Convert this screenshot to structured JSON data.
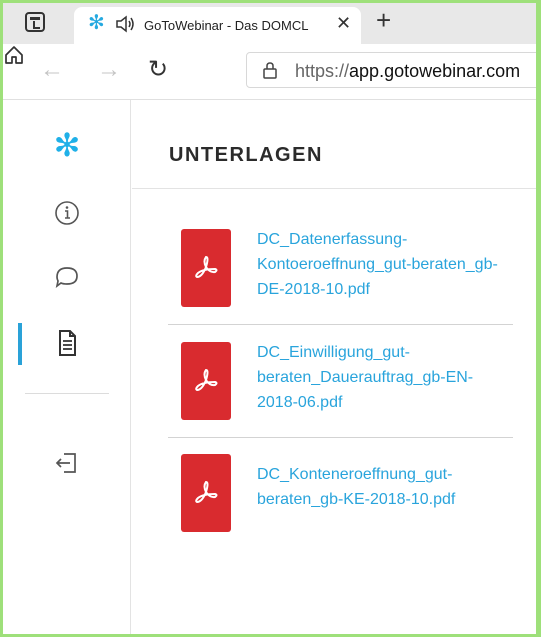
{
  "browser": {
    "tab": {
      "title": "GoToWebinar - Das DOMCL",
      "favicon": "snowflake-icon",
      "audio_icon": "speaker-icon",
      "close_icon": "close-icon"
    },
    "new_tab_icon": "plus-icon",
    "address": {
      "prefix": "https://",
      "host": "app.gotowebinar.com"
    },
    "nav_icons": [
      "back-arrow-icon",
      "forward-arrow-icon",
      "reload-icon",
      "home-icon",
      "lock-icon"
    ]
  },
  "sidebar": {
    "items": [
      {
        "icon": "gotowebinar-logo-icon",
        "active": false
      },
      {
        "icon": "info-icon",
        "active": false
      },
      {
        "icon": "chat-bubble-icon",
        "active": false
      },
      {
        "icon": "document-icon",
        "active": true
      },
      {
        "icon": "exit-icon",
        "active": false
      }
    ],
    "accent": "#2aa2d8"
  },
  "panel": {
    "title": "UNTERLAGEN",
    "documents": [
      {
        "name": "DC_Datenerfassung-Kontoeroeffnung_gut-beraten_gb-DE-2018-10.pdf",
        "icon": "pdf-icon"
      },
      {
        "name": "DC_Einwilligung_gut-beraten_Dauerauftrag_gb-EN-2018-06.pdf",
        "icon": "pdf-icon"
      },
      {
        "name": "DC_Konteneroeffnung_gut-beraten_gb-KE-2018-10.pdf",
        "icon": "pdf-icon"
      }
    ]
  },
  "colors": {
    "link": "#29a4dc",
    "pdf_red": "#d92b2f",
    "brand": "#1fb0e8"
  }
}
